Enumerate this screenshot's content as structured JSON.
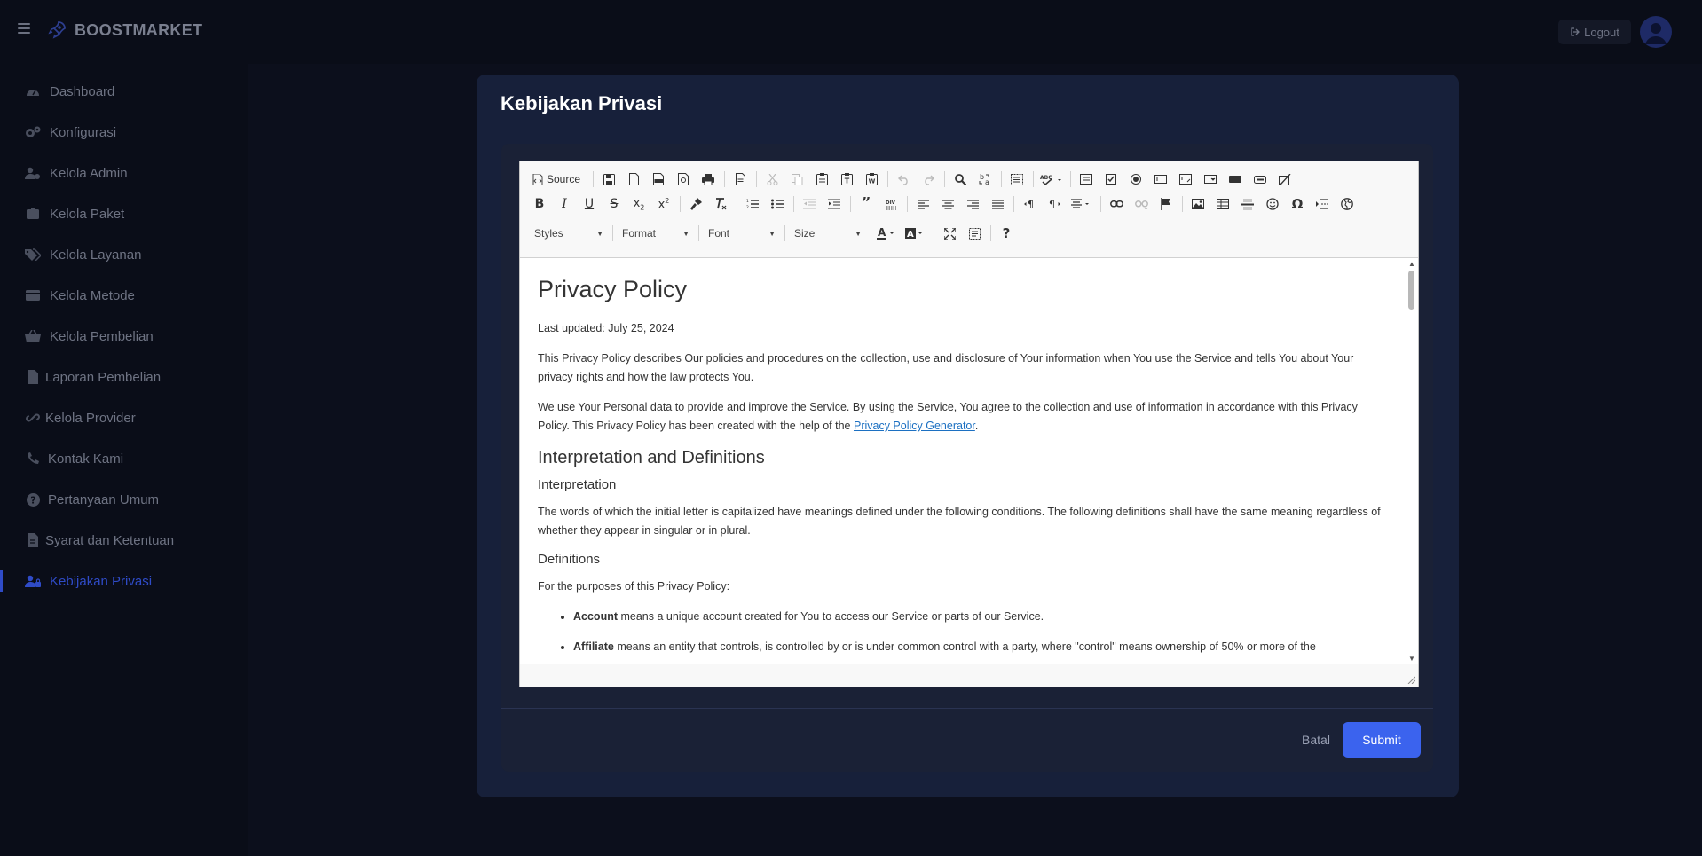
{
  "app": {
    "brand": "BOOSTMARKET"
  },
  "header": {
    "logout_label": "Logout"
  },
  "sidebar": {
    "items": [
      {
        "label": "Dashboard",
        "icon": "gauge-icon"
      },
      {
        "label": "Konfigurasi",
        "icon": "gears-icon"
      },
      {
        "label": "Kelola Admin",
        "icon": "user-gear-icon"
      },
      {
        "label": "Kelola Paket",
        "icon": "package-icon"
      },
      {
        "label": "Kelola Layanan",
        "icon": "tags-icon"
      },
      {
        "label": "Kelola Metode",
        "icon": "credit-card-icon"
      },
      {
        "label": "Kelola Pembelian",
        "icon": "basket-icon"
      },
      {
        "label": "Laporan Pembelian",
        "icon": "file-icon"
      },
      {
        "label": "Kelola Provider",
        "icon": "link-icon"
      },
      {
        "label": "Kontak Kami",
        "icon": "phone-icon"
      },
      {
        "label": "Pertanyaan Umum",
        "icon": "question-icon"
      },
      {
        "label": "Syarat dan Ketentuan",
        "icon": "file-lines-icon"
      },
      {
        "label": "Kebijakan Privasi",
        "icon": "user-lock-icon",
        "active": true
      }
    ]
  },
  "modal": {
    "title": "Kebijakan Privasi",
    "cancel_label": "Batal",
    "submit_label": "Submit"
  },
  "editor": {
    "source_label": "Source",
    "combos": {
      "styles": "Styles",
      "format": "Format",
      "font": "Font",
      "size": "Size"
    },
    "content": {
      "h1": "Privacy Policy",
      "updated": "Last updated: July 25, 2024",
      "p1": "This Privacy Policy describes Our policies and procedures on the collection, use and disclosure of Your information when You use the Service and tells You about Your privacy rights and how the law protects You.",
      "p2_before": "We use Your Personal data to provide and improve the Service. By using the Service, You agree to the collection and use of information in accordance with this Privacy Policy. This Privacy Policy has been created with the help of the ",
      "p2_link": "Privacy Policy Generator",
      "p2_after": ".",
      "h2": "Interpretation and Definitions",
      "h3_interp": "Interpretation",
      "p3": "The words of which the initial letter is capitalized have meanings defined under the following conditions. The following definitions shall have the same meaning regardless of whether they appear in singular or in plural.",
      "h3_def": "Definitions",
      "p4": "For the purposes of this Privacy Policy:",
      "li1_term": "Account",
      "li1_text": " means a unique account created for You to access our Service or parts of our Service.",
      "li2_term": "Affiliate",
      "li2_text": " means an entity that controls, is controlled by or is under common control with a party, where \"control\" means ownership of 50% or more of the"
    }
  },
  "colors": {
    "accent": "#3b63ee",
    "modal_bg": "#17203a",
    "active_nav": "#2f4bc7"
  }
}
